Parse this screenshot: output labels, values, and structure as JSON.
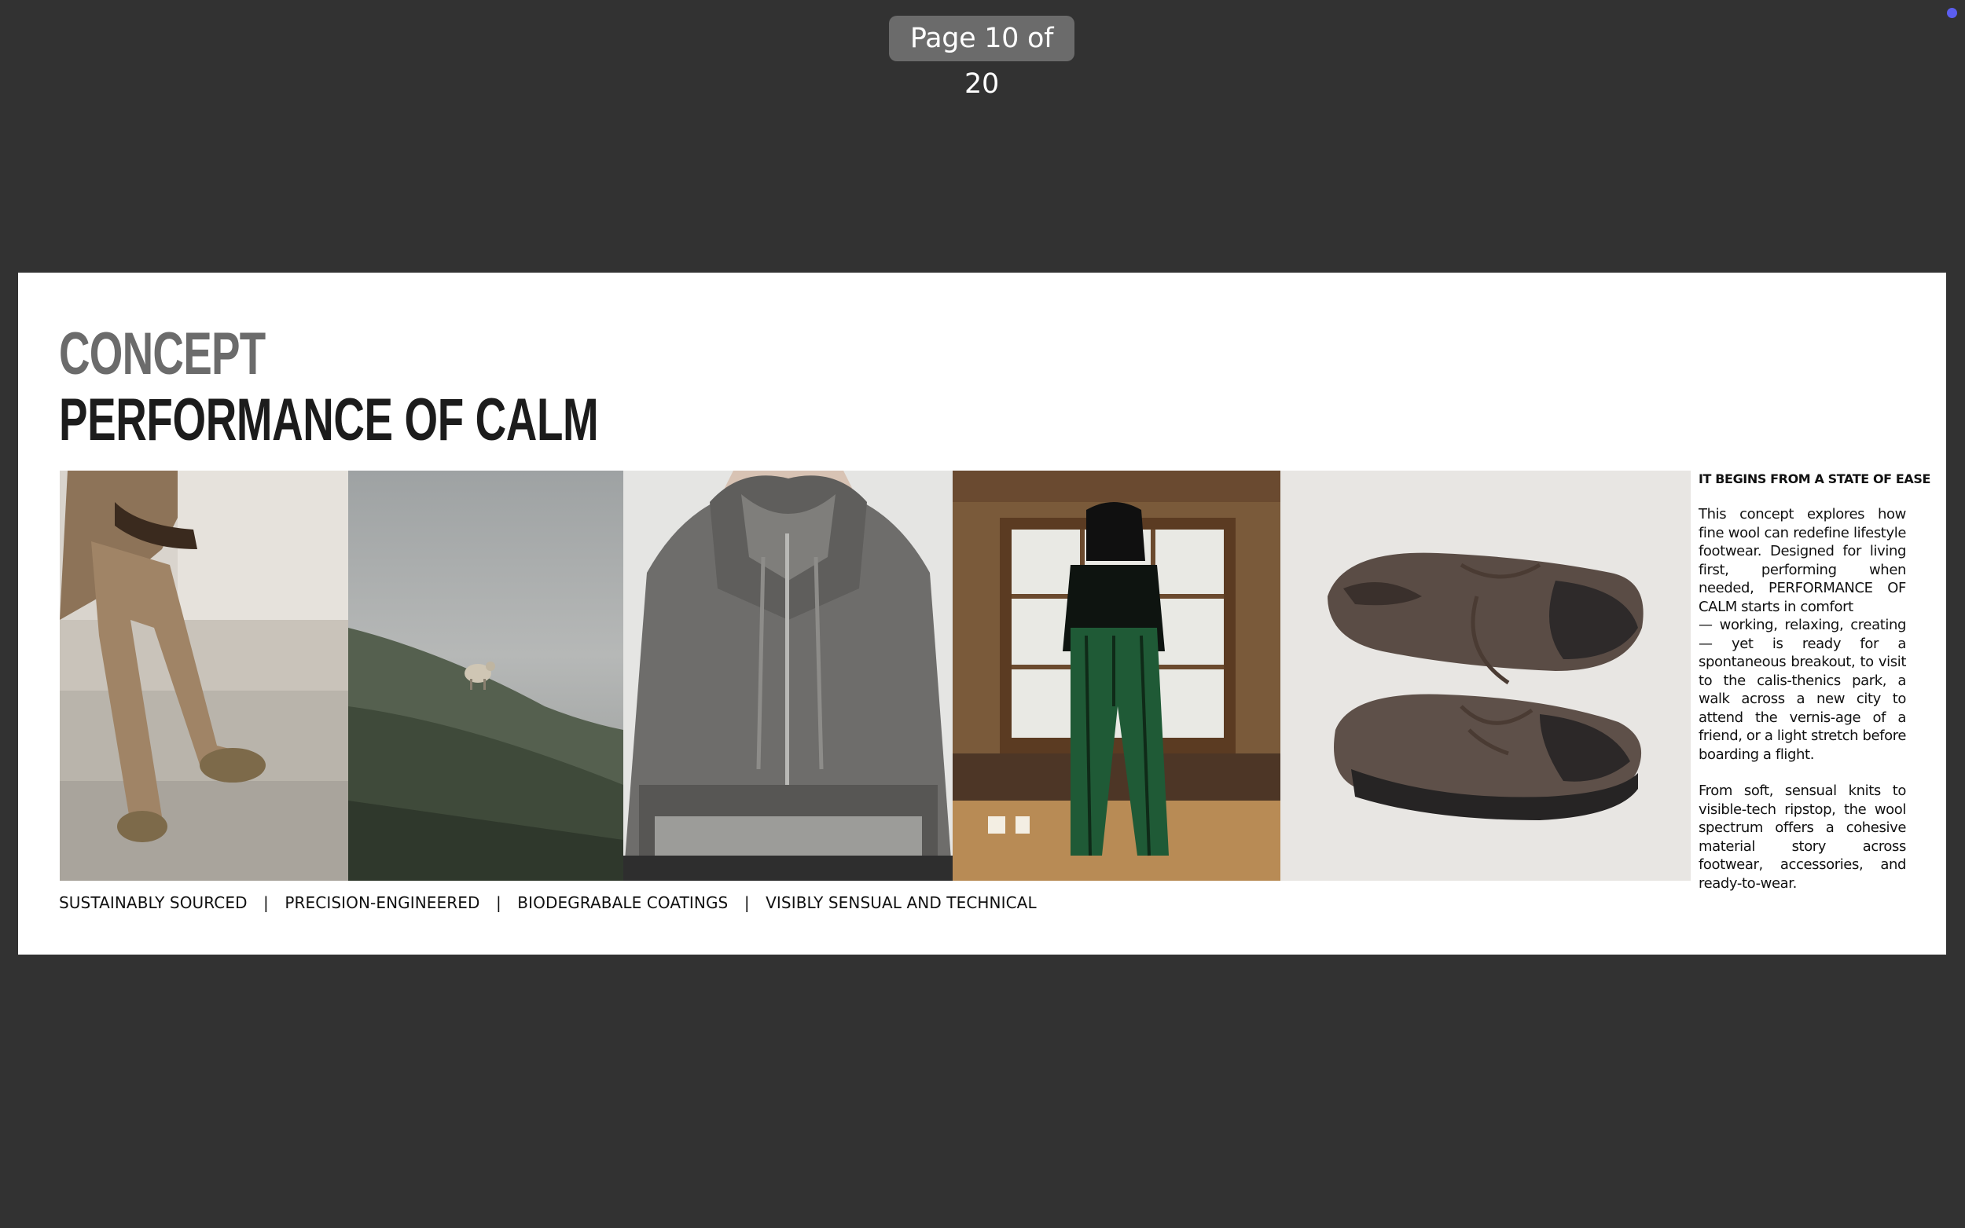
{
  "viewer": {
    "page_indicator": "Page 10 of 20",
    "status_dot_color": "#5b5ef0"
  },
  "slide": {
    "title_line_1": "CONCEPT",
    "title_line_2": "PERFORMANCE OF CALM",
    "photos": [
      {
        "icon": "photo-seated-person-trousers"
      },
      {
        "icon": "photo-misty-hillside-sheep"
      },
      {
        "icon": "photo-grey-knit-hoodie"
      },
      {
        "icon": "photo-person-green-trousers-room"
      },
      {
        "icon": "photo-brown-sneakers"
      }
    ],
    "side": {
      "heading": "IT BEGINS FROM A STATE OF EASE",
      "paragraph_1": "This concept explores how fine wool can redefine lifestyle footwear. Designed for living first, performing when needed, PERFORMANCE OF CALM  starts in comfort",
      "paragraph_1b": "— working, relaxing, creating — yet is ready for a spontaneous breakout, to visit to the calis-thenics park, a walk across a new city to attend the vernis-age of a friend, or a light stretch before boarding a flight.",
      "paragraph_2": "From soft, sensual knits to visible-tech ripstop, the wool spectrum offers a cohesive material story across footwear, accessories, and ready-to-wear."
    },
    "tagline": {
      "items": [
        "SUSTAINABLY SOURCED",
        "PRECISION-ENGINEERED",
        "BIODEGRABALE COATINGS",
        "VISIBLY SENSUAL AND TECHNICAL"
      ],
      "separator": "|"
    }
  }
}
